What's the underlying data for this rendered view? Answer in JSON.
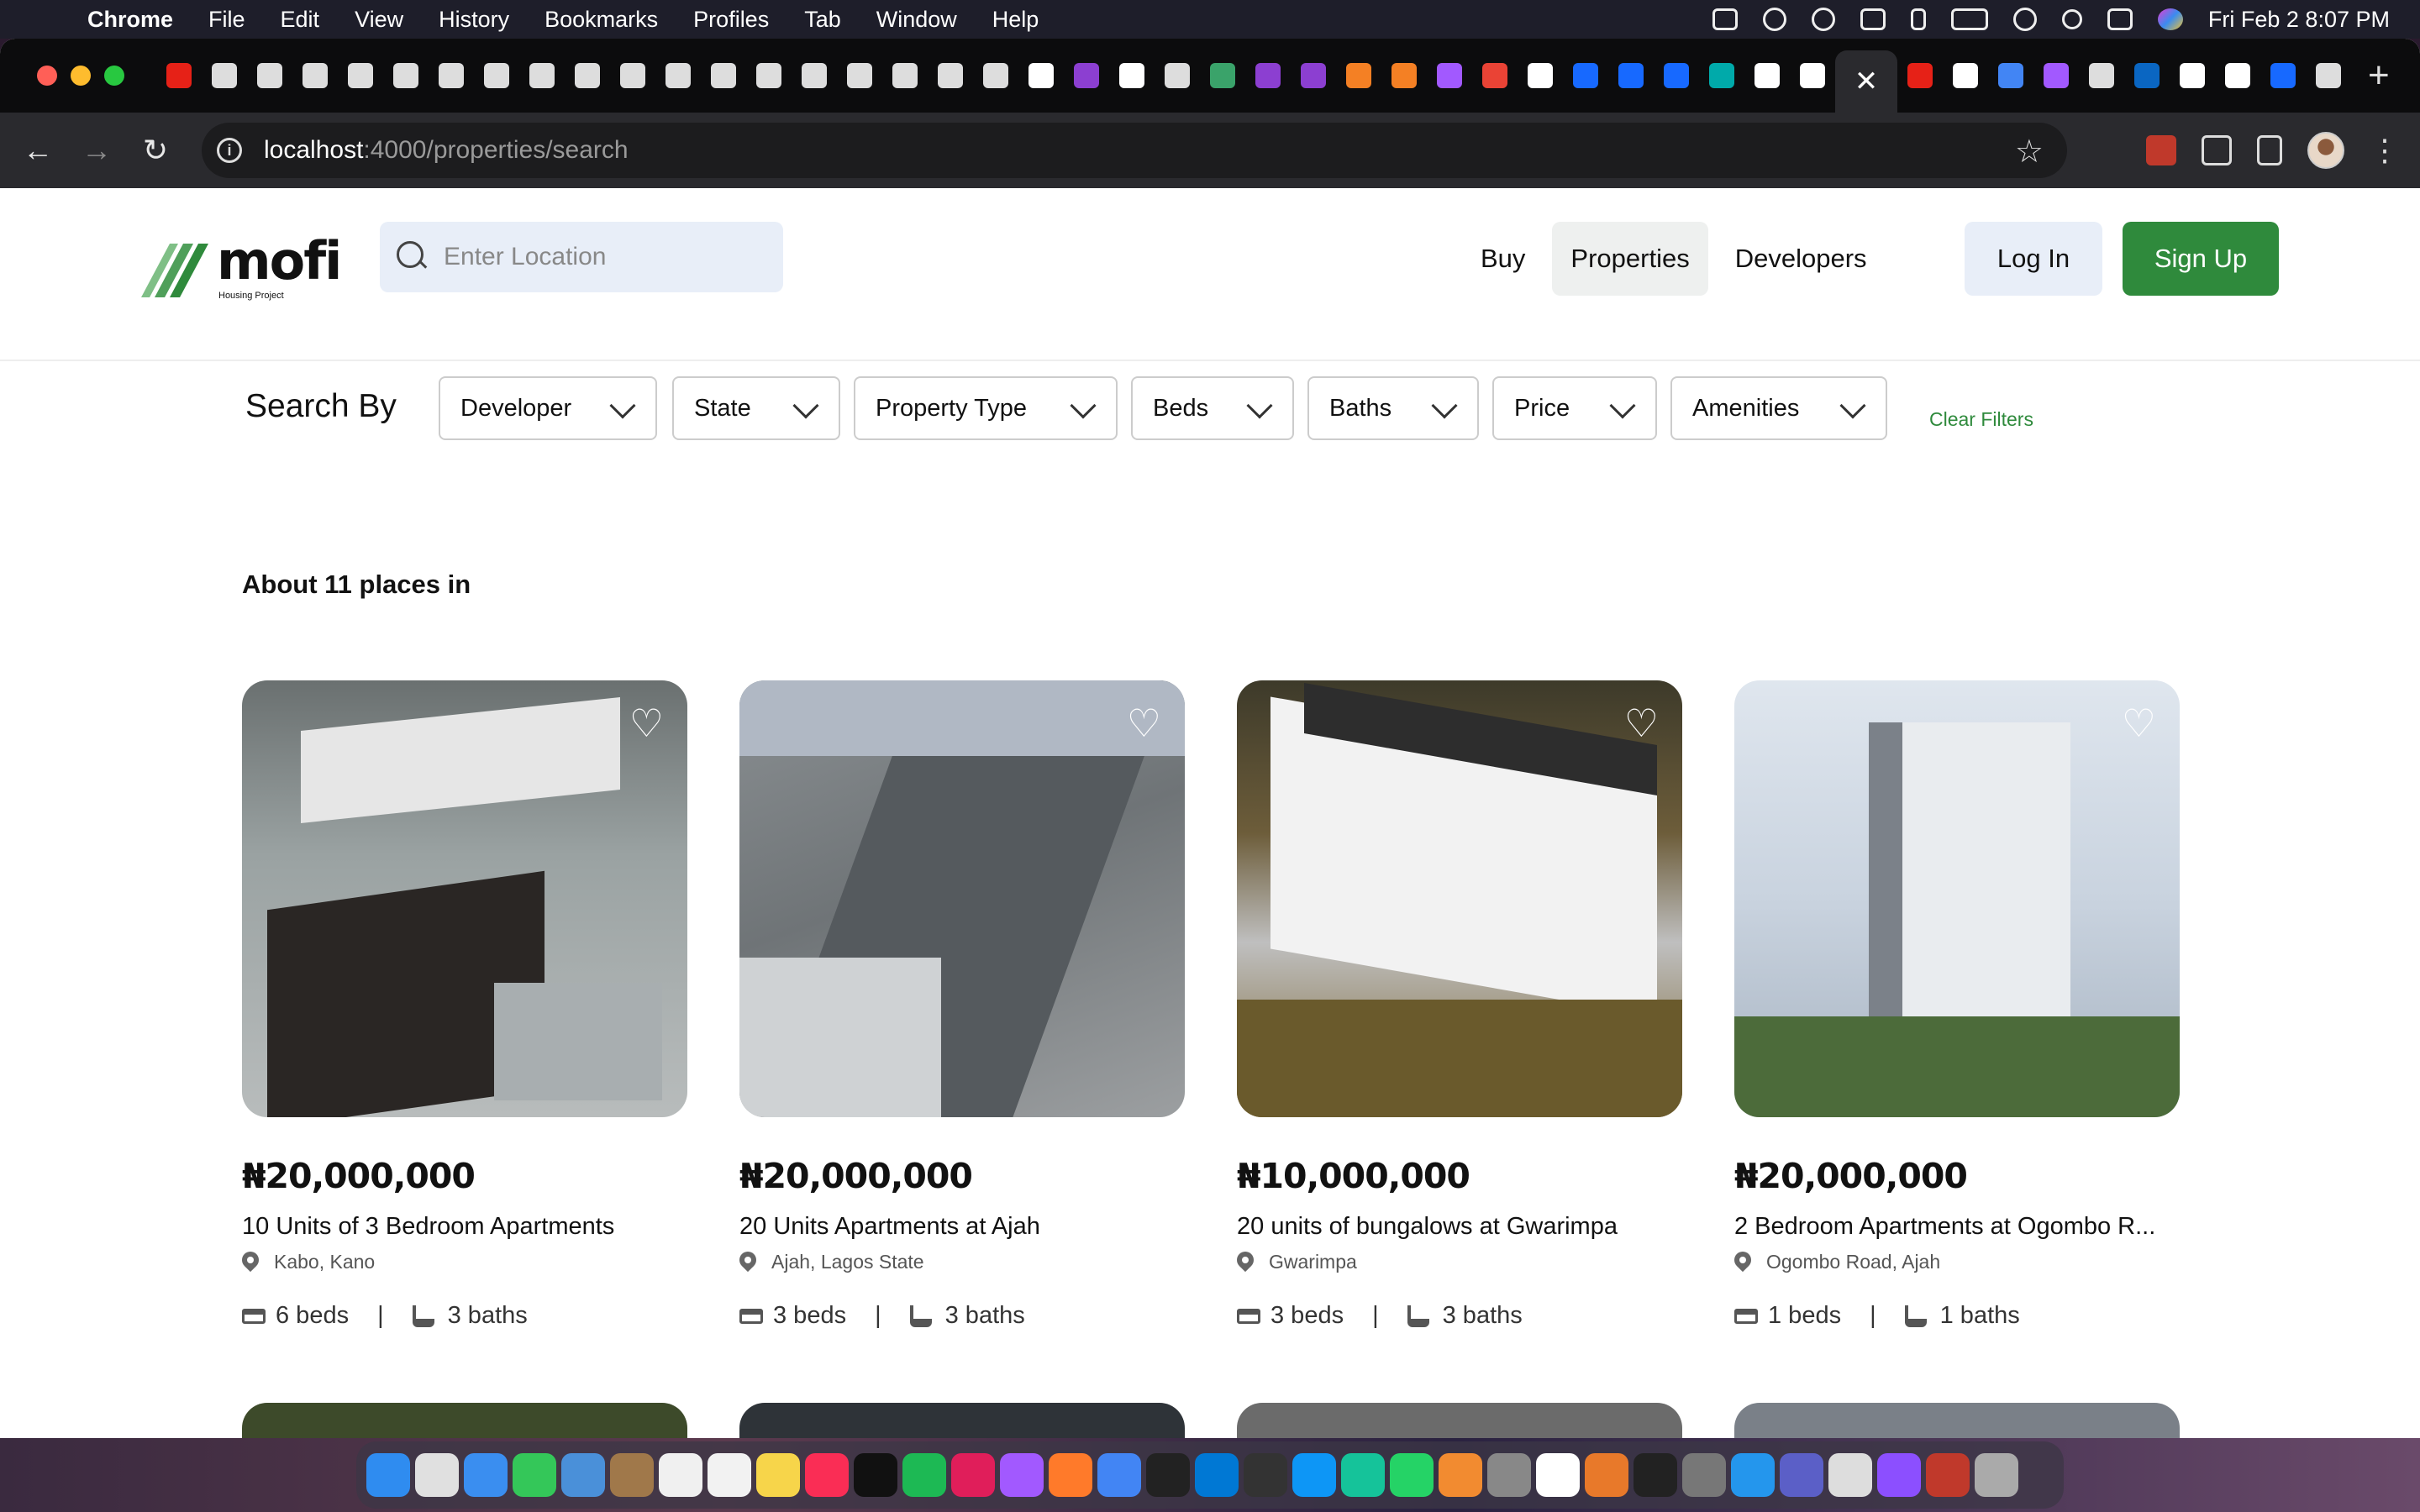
{
  "menubar": {
    "app": "Chrome",
    "items": [
      "File",
      "Edit",
      "View",
      "History",
      "Bookmarks",
      "Profiles",
      "Tab",
      "Window",
      "Help"
    ],
    "clock": "Fri Feb 2  8:07 PM"
  },
  "browser": {
    "url_host": "localhost",
    "url_path": ":4000/properties/search",
    "active_tab_close": "✕",
    "new_tab": "+"
  },
  "site": {
    "logo_text": "mofi",
    "logo_sub": "Housing Project",
    "search_placeholder": "Enter Location",
    "nav": [
      "Buy",
      "Properties",
      "Developers"
    ],
    "login": "Log In",
    "signup": "Sign Up"
  },
  "filters": {
    "label": "Search By",
    "dropdowns": [
      "Developer",
      "State",
      "Property Type",
      "Beds",
      "Baths",
      "Price",
      "Amenities"
    ],
    "clear": "Clear Filters"
  },
  "results_text": "About 11 places in",
  "listings": [
    {
      "price": "₦20,000,000",
      "title": "10 Units of 3 Bedroom Apartments",
      "location": "Kabo, Kano",
      "beds": "6 beds",
      "baths": "3 baths"
    },
    {
      "price": "₦20,000,000",
      "title": "20 Units Apartments at Ajah",
      "location": "Ajah, Lagos State",
      "beds": "3 beds",
      "baths": "3 baths"
    },
    {
      "price": "₦10,000,000",
      "title": "20 units of bungalows at Gwarimpa",
      "location": "Gwarimpa",
      "beds": "3 beds",
      "baths": "3 baths"
    },
    {
      "price": "₦20,000,000",
      "title": "2 Bedroom Apartments at Ogombo R...",
      "location": "Ogombo Road, Ajah",
      "beds": "1 beds",
      "baths": "1 baths"
    }
  ],
  "colors": {
    "brand_green": "#2f8a3c",
    "search_bg": "#e8eef8"
  }
}
